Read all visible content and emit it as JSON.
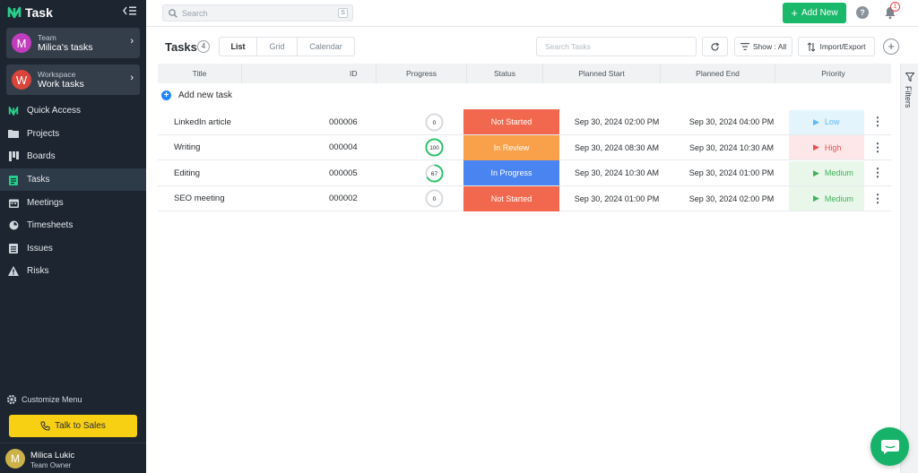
{
  "app": {
    "name": "Task"
  },
  "sidebar": {
    "team": {
      "label": "Team",
      "name": "Milica's tasks",
      "avatar": "M",
      "avatar_color": "#c23dbd"
    },
    "workspace": {
      "label": "Workspace",
      "name": "Work tasks",
      "avatar": "W",
      "avatar_color": "#d9453a"
    },
    "items": [
      {
        "label": "Quick Access",
        "icon": "quick-access-logo-icon"
      },
      {
        "label": "Projects",
        "icon": "folder-icon"
      },
      {
        "label": "Boards",
        "icon": "board-icon"
      },
      {
        "label": "Tasks",
        "icon": "task-icon",
        "active": true
      },
      {
        "label": "Meetings",
        "icon": "calendar-icon"
      },
      {
        "label": "Timesheets",
        "icon": "timer-icon"
      },
      {
        "label": "Issues",
        "icon": "issue-list-icon"
      },
      {
        "label": "Risks",
        "icon": "warning-icon"
      }
    ],
    "customize_label": "Customize Menu",
    "sales_button_label": "Talk to Sales",
    "user": {
      "name": "Milica Lukic",
      "role": "Team Owner",
      "avatar": "M"
    }
  },
  "topbar": {
    "search_placeholder": "Search",
    "search_shortcut": "S",
    "add_new_label": "Add New",
    "notification_count": "1"
  },
  "toolbar": {
    "title": "Tasks",
    "count": "4",
    "views": [
      "List",
      "Grid",
      "Calendar"
    ],
    "active_view": "List",
    "search_placeholder": "Search Tasks",
    "show_label": "Show : All",
    "import_export_label": "Import/Export"
  },
  "table": {
    "columns": [
      "Title",
      "ID",
      "Progress",
      "Status",
      "Planned Start",
      "Planned End",
      "Priority"
    ],
    "add_label": "Add new task",
    "rows": [
      {
        "title": "LinkedIn article",
        "id": "000006",
        "progress": 0,
        "progress_label": "0",
        "status": "Not Started",
        "status_color": "#f2684e",
        "start": "Sep 30, 2024 02:00 PM",
        "end": "Sep 30, 2024 04:00 PM",
        "priority": "Low",
        "priority_color": "#5eb8f5",
        "priority_bg": "#e3f4fd"
      },
      {
        "title": "Writing",
        "id": "000004",
        "progress": 100,
        "progress_label": "100",
        "status": "In Review",
        "status_color": "#f9a14a",
        "start": "Sep 30, 2024 08:30 AM",
        "end": "Sep 30, 2024 10:30 AM",
        "priority": "High",
        "priority_color": "#ec4e54",
        "priority_bg": "#fde7e8"
      },
      {
        "title": "Editing",
        "id": "000005",
        "progress": 67,
        "progress_label": "67",
        "status": "In Progress",
        "status_color": "#4a84f0",
        "start": "Sep 30, 2024 10:30 AM",
        "end": "Sep 30, 2024 01:00 PM",
        "priority": "Medium",
        "priority_color": "#3fb15a",
        "priority_bg": "#e9f7ea"
      },
      {
        "title": "SEO meeting",
        "id": "000002",
        "progress": 0,
        "progress_label": "0",
        "status": "Not Started",
        "status_color": "#f2684e",
        "start": "Sep 30, 2024 01:00 PM",
        "end": "Sep 30, 2024 02:00 PM",
        "priority": "Medium",
        "priority_color": "#3fb15a",
        "priority_bg": "#e9f7ea"
      }
    ]
  },
  "filters_label": "Filters"
}
